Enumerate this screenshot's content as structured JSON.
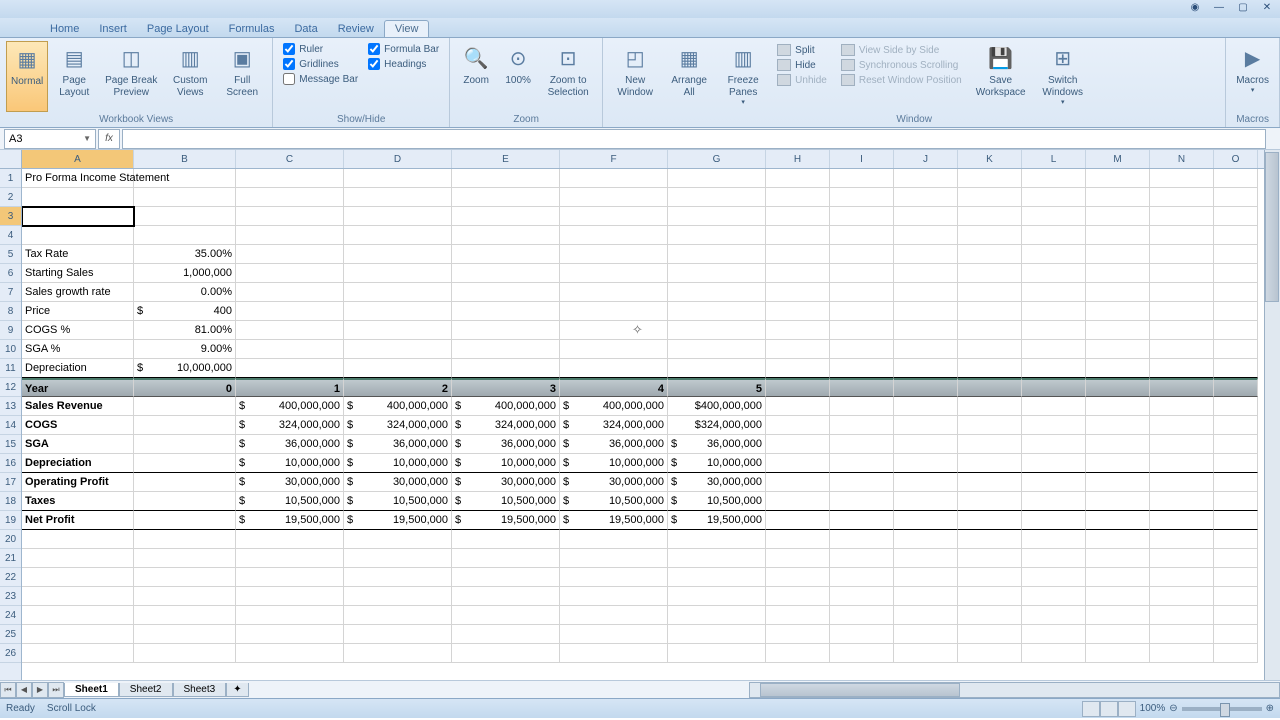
{
  "tabs": [
    "Home",
    "Insert",
    "Page Layout",
    "Formulas",
    "Data",
    "Review",
    "View"
  ],
  "active_tab": "View",
  "ribbon": {
    "workbook_views": {
      "label": "Workbook Views",
      "items": [
        "Normal",
        "Page Layout",
        "Page Break Preview",
        "Custom Views",
        "Full Screen"
      ]
    },
    "show_hide": {
      "label": "Show/Hide",
      "ruler": {
        "label": "Ruler",
        "checked": true
      },
      "gridlines": {
        "label": "Gridlines",
        "checked": true
      },
      "message_bar": {
        "label": "Message Bar",
        "checked": false
      },
      "formula_bar": {
        "label": "Formula Bar",
        "checked": true
      },
      "headings": {
        "label": "Headings",
        "checked": true
      }
    },
    "zoom": {
      "label": "Zoom",
      "items": [
        "Zoom",
        "100%",
        "Zoom to Selection"
      ]
    },
    "window": {
      "label": "Window",
      "items1": [
        "New Window",
        "Arrange All",
        "Freeze Panes"
      ],
      "split": "Split",
      "hide": "Hide",
      "unhide": "Unhide",
      "vsbs": "View Side by Side",
      "sync": "Synchronous Scrolling",
      "reset": "Reset Window Position",
      "save_ws": "Save Workspace",
      "switch": "Switch Windows"
    },
    "macros": {
      "label": "Macros",
      "btn": "Macros"
    }
  },
  "name_box": "A3",
  "formula": "",
  "columns": [
    "A",
    "B",
    "C",
    "D",
    "E",
    "F",
    "G",
    "H",
    "I",
    "J",
    "K",
    "L",
    "M",
    "N",
    "O"
  ],
  "rows_visible": 27,
  "selected_cell": {
    "row": 3,
    "col": "A"
  },
  "data": {
    "r1": {
      "A": "Pro Forma Income Statement"
    },
    "r5": {
      "A": "Tax Rate",
      "B": "35.00%"
    },
    "r6": {
      "A": "Starting Sales",
      "B": "1,000,000"
    },
    "r7": {
      "A": "Sales growth rate",
      "B": "0.00%"
    },
    "r8": {
      "A": "Price",
      "B_sym": "$",
      "B": "400"
    },
    "r9": {
      "A": "COGS %",
      "B": "81.00%"
    },
    "r10": {
      "A": "SGA %",
      "B": "9.00%"
    },
    "r11": {
      "A": "Depreciation",
      "B_sym": "$",
      "B": "10,000,000"
    },
    "r12": {
      "A": "Year",
      "B": "0",
      "C": "1",
      "D": "2",
      "E": "3",
      "F": "4",
      "G": "5"
    },
    "r13": {
      "A": "Sales Revenue",
      "vals": [
        "400,000,000",
        "400,000,000",
        "400,000,000",
        "400,000,000",
        "$400,000,000"
      ]
    },
    "r14": {
      "A": "COGS",
      "vals": [
        "324,000,000",
        "324,000,000",
        "324,000,000",
        "324,000,000",
        "$324,000,000"
      ]
    },
    "r15": {
      "A": "SGA",
      "vals": [
        "36,000,000",
        "36,000,000",
        "36,000,000",
        "36,000,000"
      ],
      "G_sym": "$",
      "G": "36,000,000"
    },
    "r16": {
      "A": "Depreciation",
      "vals": [
        "10,000,000",
        "10,000,000",
        "10,000,000",
        "10,000,000"
      ],
      "G_sym": "$",
      "G": "10,000,000"
    },
    "r17": {
      "A": "Operating Profit",
      "vals": [
        "30,000,000",
        "30,000,000",
        "30,000,000",
        "30,000,000"
      ],
      "G_sym": "$",
      "G": "30,000,000"
    },
    "r18": {
      "A": "Taxes",
      "vals": [
        "10,500,000",
        "10,500,000",
        "10,500,000",
        "10,500,000"
      ],
      "G_sym": "$",
      "G": "10,500,000"
    },
    "r19": {
      "A": "Net Profit",
      "vals": [
        "19,500,000",
        "19,500,000",
        "19,500,000",
        "19,500,000"
      ],
      "G_sym": "$",
      "G": "19,500,000"
    }
  },
  "sheets": [
    "Sheet1",
    "Sheet2",
    "Sheet3"
  ],
  "active_sheet": "Sheet1",
  "status": {
    "ready": "Ready",
    "scroll": "Scroll Lock",
    "zoom": "100%"
  }
}
